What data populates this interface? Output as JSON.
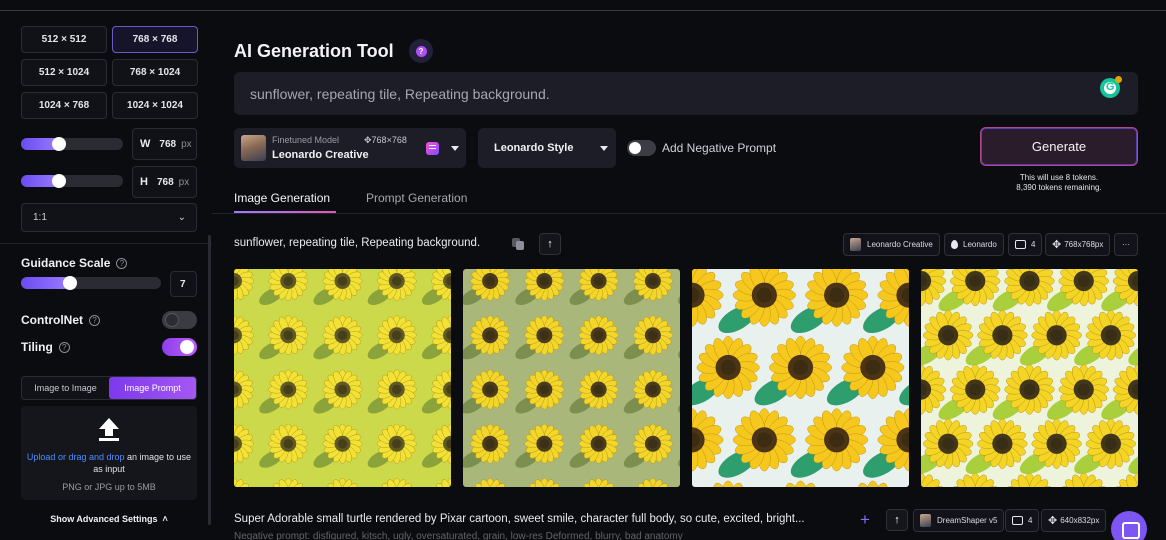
{
  "sidebar": {
    "dimensions": [
      {
        "label": "512 × 512",
        "active": false
      },
      {
        "label": "768 × 768",
        "active": true
      },
      {
        "label": "512 × 1024",
        "active": false
      },
      {
        "label": "768 × 1024",
        "active": false
      },
      {
        "label": "1024 × 768",
        "active": false
      },
      {
        "label": "1024 × 1024",
        "active": false
      }
    ],
    "width": {
      "axis": "W",
      "value": "768",
      "unit": "px",
      "level": 0.3
    },
    "height": {
      "axis": "H",
      "value": "768",
      "unit": "px",
      "level": 0.3
    },
    "aspect_ratio": "1:1",
    "guidance_scale": {
      "label": "Guidance Scale",
      "value": "7",
      "level": 0.3
    },
    "controlnet": {
      "label": "ControlNet",
      "enabled": false
    },
    "tiling": {
      "label": "Tiling",
      "enabled": true
    },
    "input_tabs": {
      "image_to_image": "Image to Image",
      "image_prompt": "Image Prompt",
      "active": "image_prompt"
    },
    "upload": {
      "link_text": "Upload or drag and drop",
      "text_rest": "an image to use as input",
      "sub_text": "PNG or JPG up to 5MB"
    },
    "advanced_settings": "Show Advanced Settings",
    "help_glyph": "?"
  },
  "main": {
    "title": "AI Generation Tool",
    "title_help_glyph": "?",
    "prompt_input": {
      "value": "sunflower, repeating tile, Repeating background."
    },
    "model": {
      "caption": "Finetuned Model",
      "dims": "768×768",
      "name": "Leonardo Creative"
    },
    "style": "Leonardo Style",
    "negative_prompt_label": "Add Negative Prompt",
    "negative_prompt_enabled": false,
    "generate_label": "Generate",
    "token_note_1": "This will use 8 tokens.",
    "token_note_2": "8,390 tokens remaining.",
    "tabs": [
      {
        "label": "Image Generation",
        "active": true
      },
      {
        "label": "Prompt Generation",
        "active": false
      }
    ],
    "generation_1": {
      "prompt": "sunflower, repeating tile, Repeating background.",
      "chips": {
        "model": "Leonardo Creative",
        "style": "Leonardo",
        "count": "4",
        "size": "768x768px",
        "more": "···"
      }
    },
    "generation_2": {
      "prompt": "Super Adorable small turtle rendered by Pixar cartoon, sweet smile, character full body, so cute, excited, bright...",
      "negative": "Negative prompt: disfigured, kitsch, ugly, oversaturated, grain, low-res Deformed, blurry, bad anatomy",
      "chips": {
        "model": "DreamShaper v5",
        "count": "4",
        "size": "640x832px"
      }
    },
    "icons": {
      "upload_arrow": "upload-arrow-icon",
      "grammarly": "grammarly-icon",
      "copy": "copy-icon",
      "chat": "chat-bubble-icon"
    },
    "tile_palettes": [
      {
        "bg": "#cbd94a",
        "petal": "#f2e236",
        "center": "#5f5a22",
        "leaf": "#8aa33a"
      },
      {
        "bg": "#a9b87a",
        "petal": "#f3d62a",
        "center": "#4a3c1c",
        "leaf": "#7c8f4e"
      },
      {
        "bg": "#e9f1ee",
        "petal": "#f6c81e",
        "center": "#4b3515",
        "leaf": "#2f9e6e"
      },
      {
        "bg": "#eef3dc",
        "petal": "#f4d425",
        "center": "#43371a",
        "leaf": "#a9cf3c"
      }
    ]
  }
}
